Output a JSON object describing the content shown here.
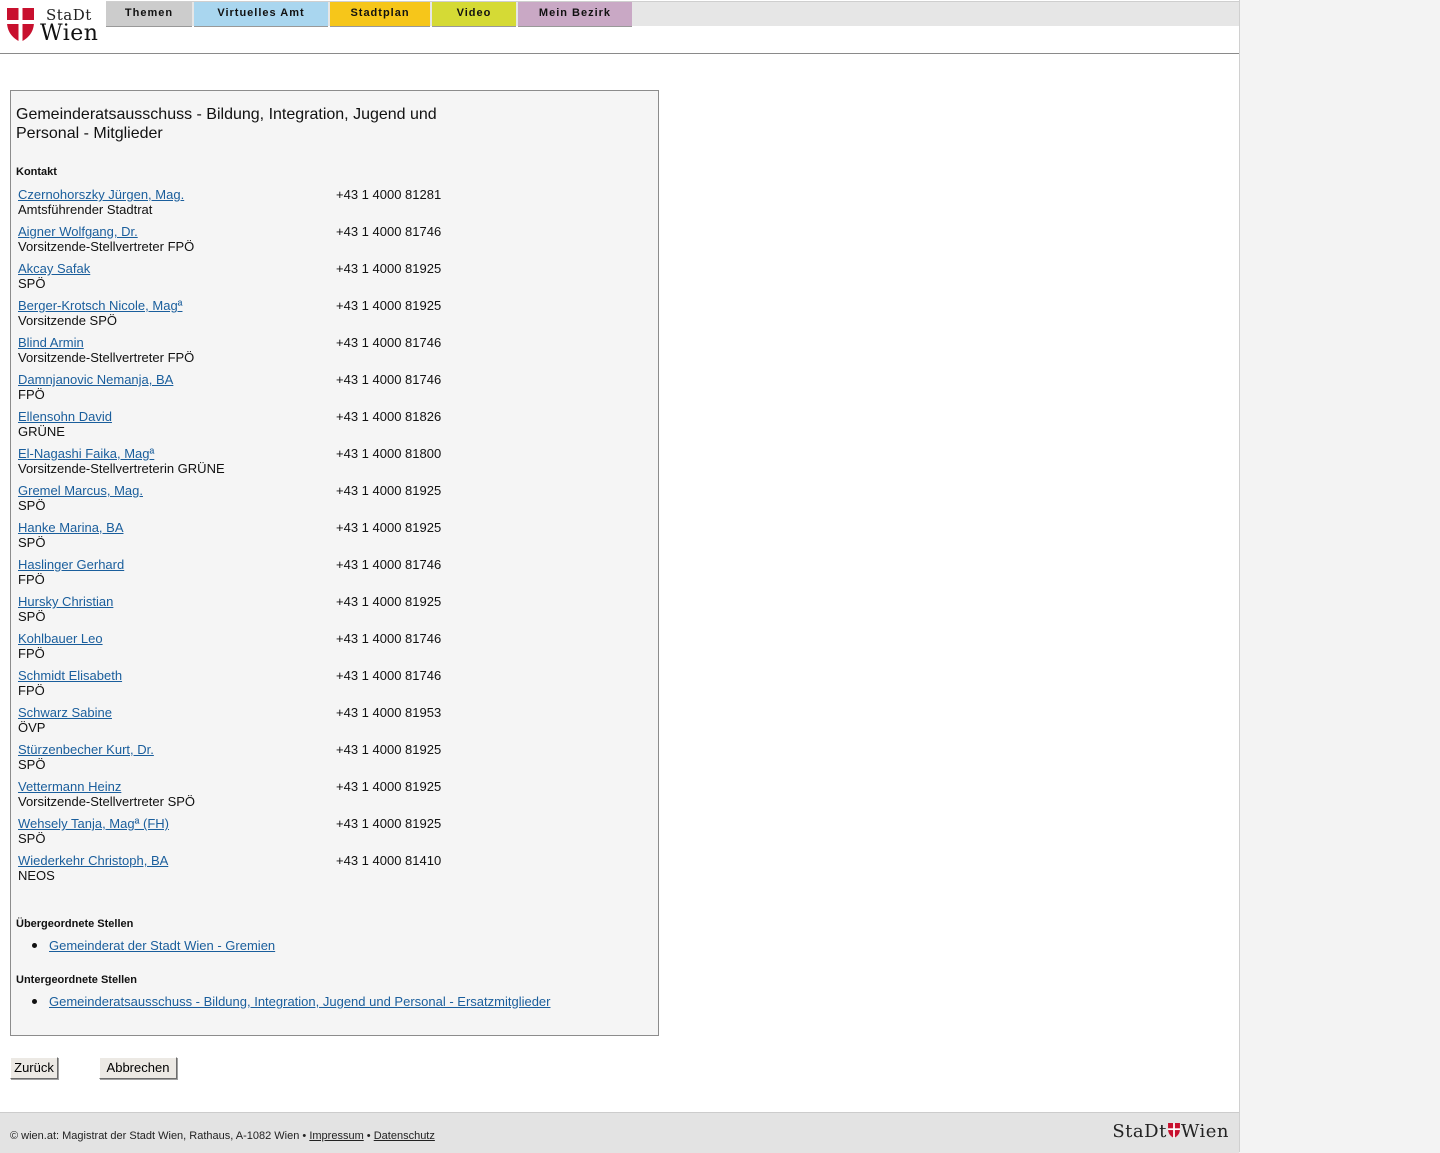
{
  "logo": {
    "line1": "StaDt",
    "line2": "Wien"
  },
  "nav": {
    "tabs": [
      {
        "label": "Themen",
        "color": "#cccccc"
      },
      {
        "label": "Virtuelles Amt",
        "color": "#a9d6ef"
      },
      {
        "label": "Stadtplan",
        "color": "#f6c61a"
      },
      {
        "label": "Video",
        "color": "#d5da35"
      },
      {
        "label": "Mein Bezirk",
        "color": "#c9a8c5"
      }
    ]
  },
  "main": {
    "title": "Gemeinderatsausschuss - Bildung, Integration, Jugend und Personal - Mitglieder",
    "contact_label": "Kontakt",
    "members": [
      {
        "name": "Czernohorszky Jürgen, Mag.",
        "role": "Amtsführender Stadtrat",
        "phone": "+43 1 4000 81281"
      },
      {
        "name": "Aigner Wolfgang, Dr.",
        "role": "Vorsitzende-Stellvertreter FPÖ",
        "phone": "+43 1 4000 81746"
      },
      {
        "name": "Akcay Safak",
        "role": "SPÖ",
        "phone": "+43 1 4000 81925"
      },
      {
        "name": "Berger-Krotsch Nicole, Magª",
        "role": "Vorsitzende SPÖ",
        "phone": "+43 1 4000 81925"
      },
      {
        "name": "Blind Armin",
        "role": "Vorsitzende-Stellvertreter FPÖ",
        "phone": "+43 1 4000 81746"
      },
      {
        "name": "Damnjanovic Nemanja, BA",
        "role": "FPÖ",
        "phone": "+43 1 4000 81746"
      },
      {
        "name": "Ellensohn David",
        "role": "GRÜNE",
        "phone": "+43 1 4000 81826"
      },
      {
        "name": "El-Nagashi Faika, Magª",
        "role": "Vorsitzende-Stellvertreterin GRÜNE",
        "phone": "+43 1 4000 81800"
      },
      {
        "name": "Gremel Marcus, Mag.",
        "role": "SPÖ",
        "phone": "+43 1 4000 81925"
      },
      {
        "name": "Hanke Marina, BA",
        "role": "SPÖ",
        "phone": "+43 1 4000 81925"
      },
      {
        "name": "Haslinger Gerhard",
        "role": "FPÖ",
        "phone": "+43 1 4000 81746"
      },
      {
        "name": "Hursky Christian",
        "role": "SPÖ",
        "phone": "+43 1 4000 81925"
      },
      {
        "name": "Kohlbauer Leo",
        "role": "FPÖ",
        "phone": "+43 1 4000 81746"
      },
      {
        "name": "Schmidt Elisabeth",
        "role": "FPÖ",
        "phone": "+43 1 4000 81746"
      },
      {
        "name": "Schwarz Sabine",
        "role": "ÖVP",
        "phone": "+43 1 4000 81953"
      },
      {
        "name": "Stürzenbecher Kurt, Dr.",
        "role": "SPÖ",
        "phone": "+43 1 4000 81925"
      },
      {
        "name": "Vettermann Heinz",
        "role": "Vorsitzende-Stellvertreter SPÖ",
        "phone": "+43 1 4000 81925"
      },
      {
        "name": "Wehsely Tanja, Magª (FH)",
        "role": "SPÖ",
        "phone": "+43 1 4000 81925"
      },
      {
        "name": "Wiederkehr Christoph, BA",
        "role": "NEOS",
        "phone": "+43 1 4000 81410"
      }
    ],
    "parent_label": "Übergeordnete Stellen",
    "parent_links": [
      "Gemeinderat der Stadt Wien - Gremien"
    ],
    "child_label": "Untergeordnete Stellen",
    "child_links": [
      "Gemeinderatsausschuss - Bildung, Integration, Jugend und Personal - Ersatzmitglieder"
    ]
  },
  "buttons": {
    "back": "Zurück",
    "cancel": "Abbrechen"
  },
  "footer": {
    "text": "© wien.at: Magistrat der Stadt Wien, Rathaus, A-1082 Wien •",
    "impressum": "Impressum",
    "separator": "•",
    "datenschutz": "Datenschutz",
    "logo_left": "StaDt",
    "logo_right": "Wien"
  },
  "colors": {
    "link": "#1a5e9c",
    "shield_red": "#c8102e"
  }
}
